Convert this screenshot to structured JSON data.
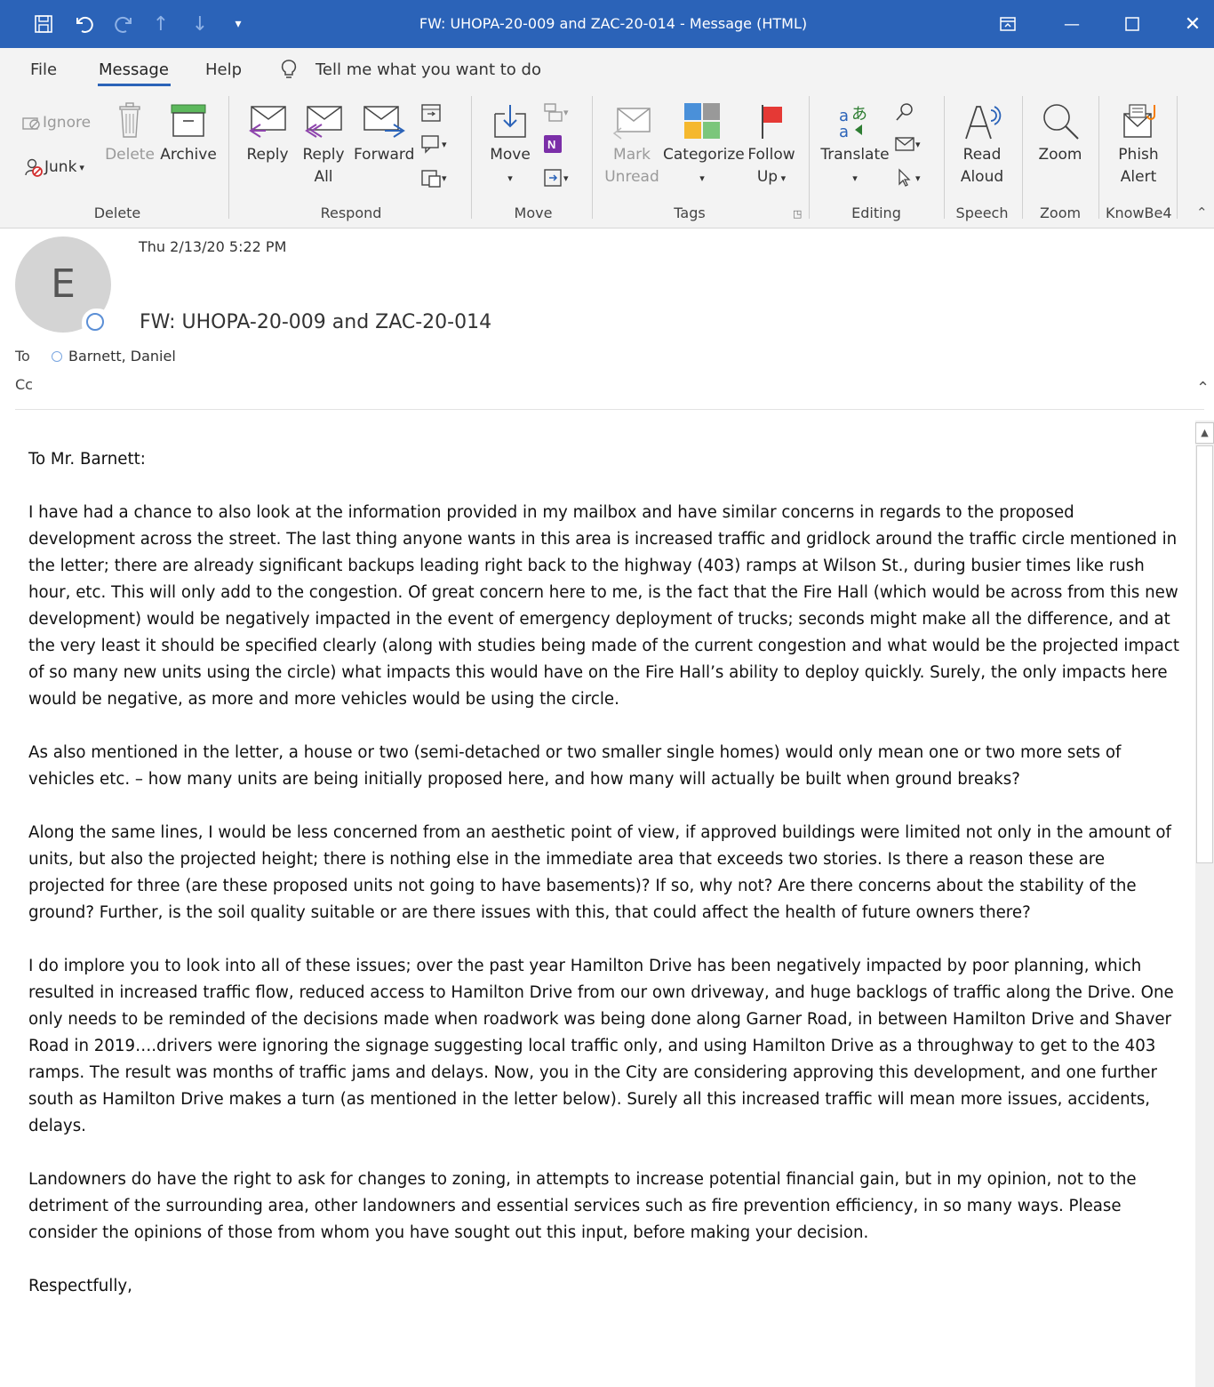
{
  "window": {
    "title": "FW: UHOPA-20-009 and ZAC-20-014  -  Message (HTML)",
    "accent_color": "#2b63b8"
  },
  "quick_access": {
    "icons": [
      "save-icon",
      "undo-icon",
      "redo-icon",
      "up-arrow-icon",
      "down-arrow-icon",
      "customize-icon"
    ]
  },
  "menu": {
    "items": [
      "File",
      "Message",
      "Help"
    ],
    "active": "Message",
    "tell_me": "Tell me what you want to do"
  },
  "ribbon": {
    "delete_group": {
      "label": "Delete",
      "ignore": "Ignore",
      "junk": "Junk",
      "delete": "Delete",
      "archive": "Archive"
    },
    "respond_group": {
      "label": "Respond",
      "reply": "Reply",
      "reply_all_1": "Reply",
      "reply_all_2": "All",
      "forward": "Forward"
    },
    "move_group": {
      "label": "Move",
      "move": "Move"
    },
    "tags_group": {
      "label": "Tags",
      "mark_1": "Mark",
      "mark_2": "Unread",
      "categorize": "Categorize",
      "follow_1": "Follow",
      "follow_2": "Up"
    },
    "editing_group": {
      "label": "Editing",
      "translate": "Translate"
    },
    "speech_group": {
      "label": "Speech",
      "read_1": "Read",
      "read_2": "Aloud"
    },
    "zoom_group": {
      "label": "Zoom",
      "zoom": "Zoom"
    },
    "knowbe4_group": {
      "label": "KnowBe4",
      "phish_1": "Phish",
      "phish_2": "Alert"
    }
  },
  "message": {
    "avatar_letter": "E",
    "date": "Thu 2/13/20 5:22 PM",
    "subject": "FW: UHOPA-20-009 and ZAC-20-014",
    "to_label": "To",
    "to": "Barnett, Daniel",
    "cc_label": "Cc"
  },
  "body": {
    "greeting": "To Mr. Barnett:",
    "p1": "I have had a chance to also look at the information provided in my mailbox and have similar concerns in regards to the proposed development across the street.  The last thing anyone wants in this area is increased traffic and gridlock around the traffic circle mentioned in the letter; there are already significant backups leading right back to the highway (403) ramps at Wilson St., during busier times like rush hour, etc.  This will only add to the congestion.   Of great concern here to me, is the fact that the Fire Hall (which would be across from this new development) would be negatively impacted in the event of emergency deployment of trucks; seconds might make all the difference, and at the very least it should be specified clearly (along with studies being made of the current congestion and what would be the projected impact of so many new units using the circle) what impacts this would have on the Fire Hall’s ability to deploy quickly.  Surely, the only impacts here would be negative, as more and more vehicles would be using the circle.",
    "p2": "As also mentioned in the letter, a house or two (semi-detached or two smaller single homes) would only mean one or two more sets of vehicles etc.  – how many units are being initially proposed here, and how many will actually be built when ground breaks?",
    "p3": "Along the same lines, I would be less concerned from an aesthetic point of view, if approved buildings were limited not only in the amount of units, but also the projected height; there is nothing else in the immediate area that exceeds two stories.  Is there a reason these are projected for three (are these proposed units not going to have basements)?  If so, why not?  Are there concerns about the stability of the ground?  Further, is the soil quality suitable or are there issues with this, that could affect the health of future owners there?",
    "p4": "I do implore you to look into all of these issues; over the past year Hamilton Drive has been negatively impacted by poor planning, which resulted in increased traffic flow, reduced access to Hamilton Drive from our own driveway, and huge backlogs of traffic along the Drive.  One only needs to be reminded of the decisions made when roadwork was being done along Garner Road, in between Hamilton Drive and Shaver Road in 2019….drivers were ignoring the signage suggesting local traffic only, and using Hamilton Drive as a throughway to get to the 403 ramps.  The result was months of traffic jams and delays.  Now, you in the City are considering approving this development, and one further south as Hamilton Drive makes a turn (as mentioned in the letter below).  Surely all this increased traffic will mean more issues, accidents, delays.",
    "p5": "Landowners do have the right to ask for changes to zoning, in attempts to increase potential financial gain, but in my opinion, not to the detriment of the surrounding area, other landowners and essential services such as fire prevention efficiency, in so many ways.  Please consider the opinions of those from whom you have sought out this input, before making your decision.",
    "closing": "Respectfully,"
  }
}
